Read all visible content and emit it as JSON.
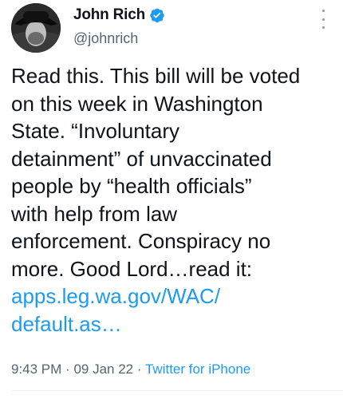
{
  "tweet": {
    "author": {
      "name": "John Rich",
      "handle": "@johnrich",
      "verified": true
    },
    "lines": [
      "Read this. This bill will be voted",
      "on this week in Washington",
      "State. “Involuntary",
      "detainment” of unvaccinated",
      "people by “health officials”",
      "with help from law",
      "enforcement. Conspiracy no",
      "more. Good Lord…read it:"
    ],
    "link_lines": [
      "apps.leg.wa.gov/WAC/",
      "default.as…"
    ],
    "time": "9:43 PM",
    "date": "09 Jan 22",
    "separator": "·",
    "source": "Twitter for iPhone"
  },
  "colors": {
    "text": "#0f1419",
    "secondary": "#536471",
    "link": "#1d9bf0",
    "verified_badge": "#1d9bf0"
  },
  "icons": {
    "verified": "verified-badge-icon",
    "more": "more-options-icon"
  }
}
